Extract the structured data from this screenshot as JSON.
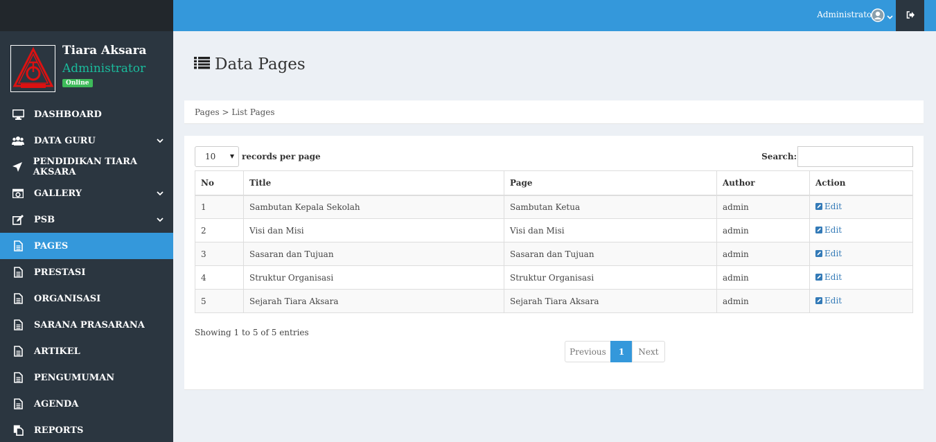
{
  "topbar": {
    "user_label": "Administrator",
    "user_icon": "user-circle-icon",
    "logout_icon": "sign-out-icon"
  },
  "sidebar": {
    "profile": {
      "logo_text": "TIARA AKSARA",
      "name": "Tiara Aksara",
      "role": "Administrator",
      "status": "Online"
    },
    "items": [
      {
        "label": "DASHBOARD",
        "icon": "desktop-icon",
        "has_children": false,
        "active": false
      },
      {
        "label": "DATA GURU",
        "icon": "users-icon",
        "has_children": true,
        "active": false
      },
      {
        "label": "PENDIDIKAN TIARA AKSARA",
        "icon": "paper-plane-icon",
        "has_children": false,
        "active": false
      },
      {
        "label": "GALLERY",
        "icon": "camera-icon",
        "has_children": true,
        "active": false
      },
      {
        "label": "PSB",
        "icon": "edit-icon",
        "has_children": true,
        "active": false
      },
      {
        "label": "PAGES",
        "icon": "file-icon",
        "has_children": false,
        "active": true
      },
      {
        "label": "PRESTASI",
        "icon": "file-icon",
        "has_children": false,
        "active": false
      },
      {
        "label": "ORGANISASI",
        "icon": "file-icon",
        "has_children": false,
        "active": false
      },
      {
        "label": "SARANA PRASARANA",
        "icon": "file-icon",
        "has_children": false,
        "active": false
      },
      {
        "label": "ARTIKEL",
        "icon": "file-icon",
        "has_children": false,
        "active": false
      },
      {
        "label": "PENGUMUMAN",
        "icon": "file-icon",
        "has_children": false,
        "active": false
      },
      {
        "label": "AGENDA",
        "icon": "file-icon",
        "has_children": false,
        "active": false
      },
      {
        "label": "REPORTS",
        "icon": "copy-icon",
        "has_children": false,
        "active": false
      }
    ]
  },
  "page": {
    "title": "Data Pages",
    "breadcrumb": "Pages > List Pages"
  },
  "table_controls": {
    "page_length": "10",
    "length_label": "records per page",
    "search_label": "Search:",
    "search_value": ""
  },
  "table": {
    "columns": [
      "No",
      "Title",
      "Page",
      "Author",
      "Action"
    ],
    "rows": [
      {
        "no": "1",
        "title": "Sambutan Kepala Sekolah",
        "page": "Sambutan Ketua",
        "author": "admin",
        "action": "Edit"
      },
      {
        "no": "2",
        "title": "Visi dan Misi",
        "page": "Visi dan Misi",
        "author": "admin",
        "action": "Edit"
      },
      {
        "no": "3",
        "title": "Sasaran dan Tujuan",
        "page": "Sasaran dan Tujuan",
        "author": "admin",
        "action": "Edit"
      },
      {
        "no": "4",
        "title": "Struktur Organisasi",
        "page": "Struktur Organisasi",
        "author": "admin",
        "action": "Edit"
      },
      {
        "no": "5",
        "title": "Sejarah Tiara Aksara",
        "page": "Sejarah Tiara Aksara",
        "author": "admin",
        "action": "Edit"
      }
    ],
    "info": "Showing 1 to 5 of 5 entries"
  },
  "pagination": {
    "previous": "Previous",
    "current": "1",
    "next": "Next"
  },
  "colors": {
    "accent": "#3498db",
    "sidebar": "#2b3640",
    "sidebar_top": "#22272c",
    "role_text": "#1abb9c",
    "online_badge": "#3ebb5a",
    "link": "#337ab7"
  }
}
